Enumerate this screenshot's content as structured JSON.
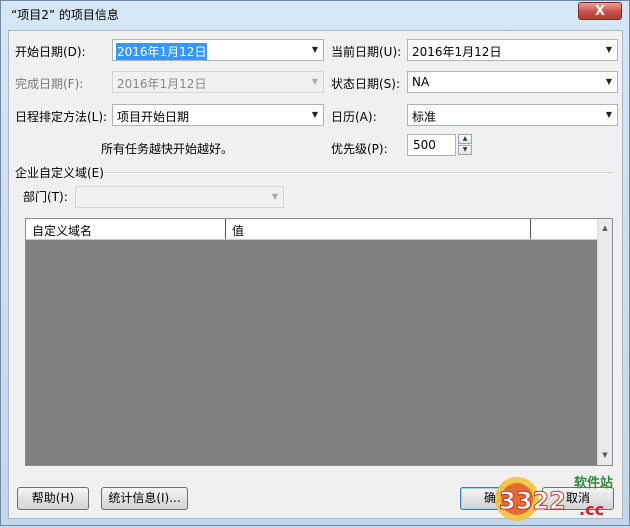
{
  "window": {
    "title": "“项目2” 的项目信息",
    "close_glyph": "X"
  },
  "fields": {
    "start_date": {
      "label": "开始日期(D):",
      "value": "2016年1月12日"
    },
    "finish_date": {
      "label": "完成日期(F):",
      "value": "2016年1月12日"
    },
    "schedule_from": {
      "label": "日程排定方法(L):",
      "value": "项目开始日期"
    },
    "schedule_note": "所有任务越快开始越好。",
    "current_date": {
      "label": "当前日期(U):",
      "value": "2016年1月12日"
    },
    "status_date": {
      "label": "状态日期(S):",
      "value": "NA"
    },
    "calendar": {
      "label": "日历(A):",
      "value": "标准"
    },
    "priority": {
      "label": "优先级(P):",
      "value": "500"
    }
  },
  "enterprise": {
    "section_label": "企业自定义域(E)",
    "department_label": "部门(T):",
    "department_value": "",
    "columns": [
      "自定义域名",
      "值"
    ]
  },
  "buttons": {
    "help": "帮助(H)",
    "statistics": "统计信息(I)...",
    "ok": "确定",
    "cancel": "取消"
  },
  "watermark": {
    "site": "软件站",
    "domain": ".cc",
    "brand": "3322"
  },
  "colors": {
    "accent": "#3399ff",
    "grid_bg": "#808080",
    "close_red": "#c75050"
  }
}
